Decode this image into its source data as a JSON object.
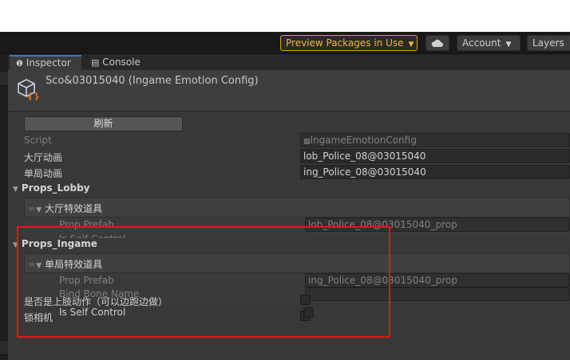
{
  "toolbar": {
    "preview_packages": "Preview Packages in Use",
    "cloud_icon": "cloud-icon",
    "account": "Account",
    "layers": "Layers"
  },
  "tabs": {
    "inspector": "Inspector",
    "console": "Console"
  },
  "header": {
    "title": "Sco&03015040 (Ingame Emotion Config)"
  },
  "refresh_button": "刷新",
  "fields": {
    "script_label": "Script",
    "script_value": "IngameEmotionConfig",
    "lobby_anim_label": "大厅动画",
    "lobby_anim_value": "lob_Police_08@03015040",
    "ingame_anim_label": "单局动画",
    "ingame_anim_value": "ing_Police_08@03015040"
  },
  "props_lobby": {
    "label": "Props_Lobby",
    "element_title": "大厅特效道具",
    "prop_prefab_label": "Prop Prefab",
    "prop_prefab_value": "lob_Police_08@03015040_prop",
    "is_self_control_label": "Is Self Control"
  },
  "props_ingame": {
    "label": "Props_Ingame",
    "element_title": "单局特效道具",
    "prop_prefab_label": "Prop Prefab",
    "prop_prefab_value": "ing_Police_08@03015040_prop",
    "is_self_control_label": "Is Self Control",
    "bind_bone_label": "Bind Bone Name"
  },
  "bottom": {
    "upper_body_label": "是否是上肢动作（可以边跑边做）",
    "lock_camera_label": "锁相机"
  },
  "colors": {
    "accent": "#3a79bb",
    "preview_border": "#d8a020",
    "highlight": "#e01818"
  }
}
